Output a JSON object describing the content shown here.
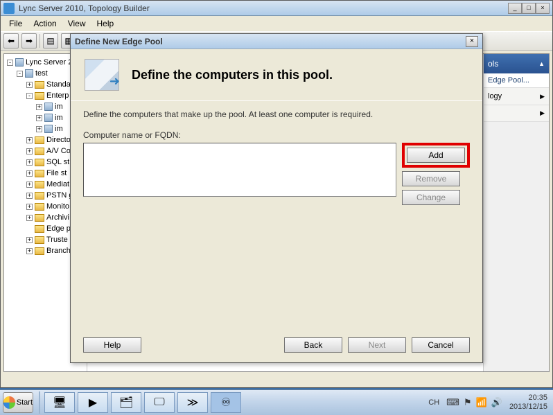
{
  "window": {
    "title": "Lync Server 2010, Topology Builder"
  },
  "menubar": [
    "File",
    "Action",
    "View",
    "Help"
  ],
  "tree": {
    "root": "Lync Server 20",
    "site": "test",
    "items": [
      "Standa",
      "Enterp",
      "Directo",
      "A/V Co",
      "SQL st",
      "File st",
      "Mediat",
      "PSTN g",
      "Monito",
      "Archivi",
      "Edge p",
      "Truste",
      "Branch"
    ],
    "enterp_sub": [
      "im",
      "im",
      "im"
    ]
  },
  "right_panel": {
    "header": "ols",
    "items": [
      "Edge Pool..."
    ],
    "subs": [
      "logy",
      ""
    ]
  },
  "dialog": {
    "title": "Define New Edge Pool",
    "header": "Define the computers in this pool.",
    "instruction": "Define the computers that make up the pool. At least one computer is required.",
    "list_label": "Computer name or FQDN:",
    "add_btn": "Add",
    "remove_btn": "Remove",
    "change_btn": "Change",
    "help_btn": "Help",
    "back_btn": "Back",
    "next_btn": "Next",
    "cancel_btn": "Cancel"
  },
  "taskbar": {
    "start": "Start",
    "ime": "CH",
    "time": "20:35",
    "date": "2013/12/15"
  }
}
